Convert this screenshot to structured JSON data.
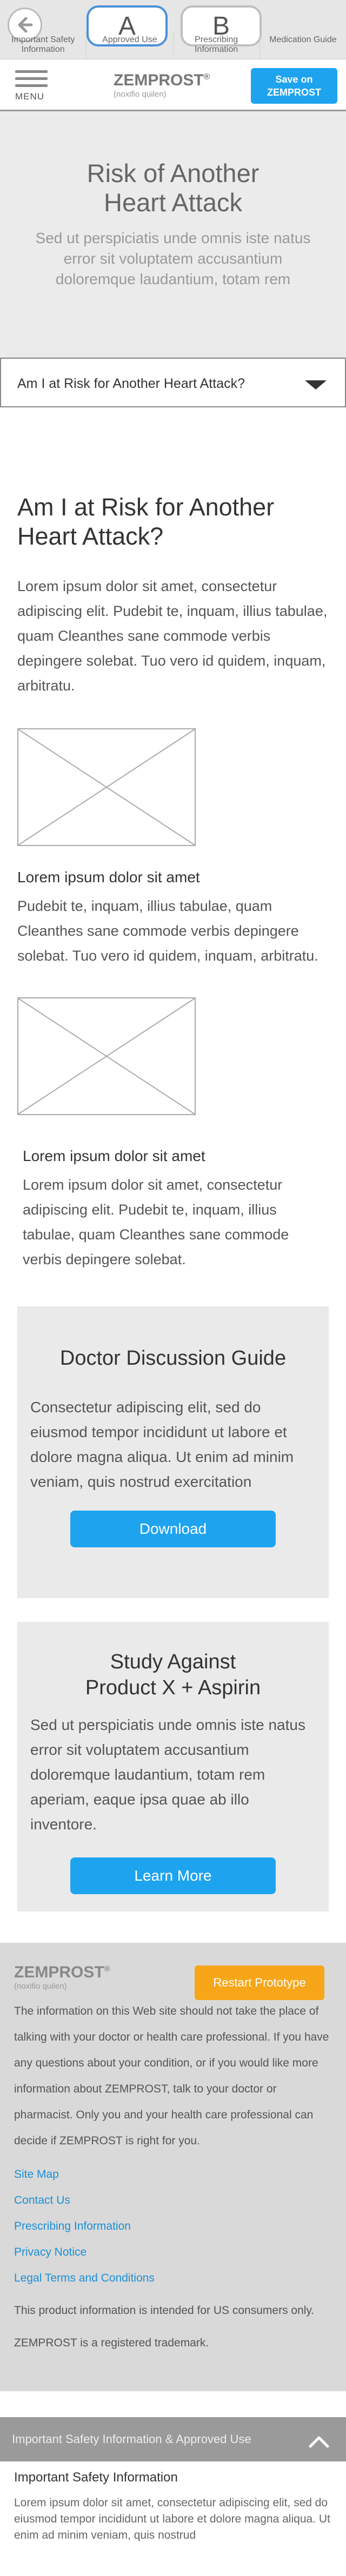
{
  "proto": {
    "variant_a": "A",
    "variant_b": "B",
    "tabs": [
      {
        "label": "Important Safety Information"
      },
      {
        "label": "Approved Use"
      },
      {
        "label": "Prescribing Information"
      },
      {
        "label": "Medication Guide"
      }
    ]
  },
  "header": {
    "menu_label": "MENU",
    "logo": "ZEMPROST",
    "logo_mark": "®",
    "logo_sub": "(noxifio quilen)",
    "save_line1": "Save on",
    "save_line2": "ZEMPROST"
  },
  "hero": {
    "title": "Risk of Another Heart Attack",
    "subtitle": "Sed ut perspiciatis unde omnis iste natus error sit voluptatem accusantium doloremque laudantium, totam rem"
  },
  "jump": {
    "selected": "Am I at Risk for Another Heart Attack?"
  },
  "main": {
    "heading": "Am I at Risk for Another Heart Attack?",
    "intro": "Lorem ipsum dolor sit amet, consectetur adipiscing elit. Pudebit te, inquam, illius tabulae, quam Cleanthes sane commode verbis depingere solebat. Tuo vero id quidem, inquam, arbitratu.",
    "section1_title": "Lorem ipsum dolor sit amet",
    "section1_text": "Pudebit te, inquam, illius tabulae, quam Cleanthes sane commode verbis depingere solebat. Tuo vero id quidem, inquam, arbitratu.",
    "section2_title": "Lorem ipsum dolor sit amet",
    "section2_text": "Lorem ipsum dolor sit amet, consectetur adipiscing elit. Pudebit te, inquam, illius tabulae, quam Cleanthes sane commode verbis depingere solebat."
  },
  "cards": {
    "guide_title": "Doctor Discussion Guide",
    "guide_text": "Consectetur adipiscing elit, sed do eiusmod tempor incididunt ut labore et dolore magna aliqua. Ut enim ad minim veniam, quis nostrud exercitation",
    "guide_button": "Download",
    "study_title": "Study Against Product X + Aspirin",
    "study_text": "Sed ut perspiciatis unde omnis iste natus error sit voluptatem accusantium doloremque laudantium, totam rem aperiam, eaque ipsa quae ab illo inventore.",
    "study_button": "Learn More"
  },
  "footer": {
    "logo": "ZEMPROST",
    "logo_mark": "®",
    "logo_sub": "(noxifio quilen)",
    "restart_label": "Restart Prototype",
    "disclaimer": "The information on this Web site should not take the place of talking with your doctor or health care professional. If you have any questions about your condition, or if you would like more information about ZEMPROST, talk to your doctor or pharmacist. Only you and your health care professional can decide if ZEMPROST is right for you.",
    "links": [
      {
        "label": "Site Map"
      },
      {
        "label": "Contact Us"
      },
      {
        "label": "Prescribing Information"
      },
      {
        "label": "Privacy Notice"
      },
      {
        "label": "Legal Terms and Conditions"
      }
    ],
    "us_note": "This product information is intended for US consumers only.",
    "trademark": "ZEMPROST is a registered trademark."
  },
  "isi": {
    "bar_label": "Important Safety Information & Approved Use",
    "heading": "Important Safety Information",
    "text": "Lorem ipsum dolor sit amet, consectetur adipiscing elit, sed do eiusmod tempor incididunt ut labore et dolore magna aliqua. Ut enim ad minim veniam, quis nostrud"
  },
  "colors": {
    "accent_blue": "#1ea3ef",
    "restart_orange": "#f7a61a",
    "hero_bg": "#ebebeb",
    "footer_bg": "#d9d9d9"
  }
}
